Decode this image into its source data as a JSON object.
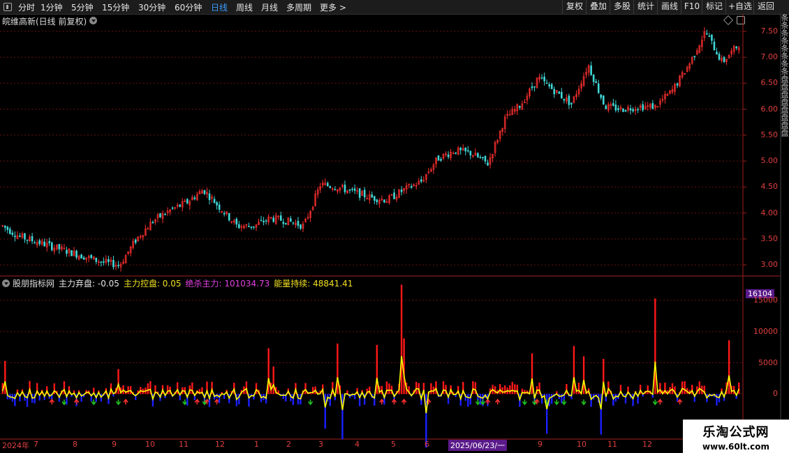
{
  "toolbar": {
    "periods": [
      "分时",
      "1分钟",
      "5分钟",
      "15分钟",
      "30分钟",
      "60分钟",
      "日线",
      "周线",
      "月线",
      "多周期",
      "更多 >"
    ],
    "active": "日线",
    "right": [
      "复权",
      "叠加",
      "多股",
      "统计",
      "画线",
      "F10",
      "标记",
      "+自选",
      "返回"
    ]
  },
  "chart_title": "皖维高新(日线 前复权)",
  "price_axis": [
    "7.50",
    "7.00",
    "6.50",
    "6.00",
    "5.50",
    "5.00",
    "4.50",
    "4.00",
    "3.50",
    "3.00"
  ],
  "indicator": {
    "name": "股朋指标网",
    "items": [
      {
        "label": "主力弃盘:",
        "value": "-0.05",
        "color": "#e6e6e6"
      },
      {
        "label": "主力控盘:",
        "value": "0.05",
        "color": "#f0e020"
      },
      {
        "label": "绝杀主力:",
        "value": "101034.73",
        "color": "#e040e0"
      },
      {
        "label": "能量持续:",
        "value": "48841.41",
        "color": "#f0e020"
      }
    ]
  },
  "ind_axis": [
    "15000",
    "10000",
    "5000",
    "0"
  ],
  "ind_current": "16104",
  "dates": [
    "2024年",
    "7",
    "8",
    "9",
    "10",
    "11",
    "12",
    "1",
    "2",
    "3",
    "4",
    "5",
    "6",
    "2025/06/23/一",
    "9",
    "10",
    "11",
    "12"
  ],
  "watermark": {
    "name": "乐淘公式网",
    "url": "www.60lt.com"
  },
  "side_strip": "条条条条条条条条盘盘盘盘盘盘盘盘",
  "chart_data": {
    "type": "candlestick",
    "price_ylim": [
      2.8,
      7.7
    ],
    "trend": [
      3.75,
      3.55,
      3.45,
      3.35,
      3.25,
      3.15,
      3.05,
      3.0,
      3.5,
      3.85,
      4.05,
      4.2,
      4.45,
      4.1,
      3.75,
      3.75,
      3.9,
      3.85,
      3.75,
      4.55,
      4.5,
      4.4,
      4.3,
      4.25,
      4.45,
      4.6,
      5.05,
      5.2,
      5.15,
      4.95,
      5.8,
      6.1,
      6.6,
      6.35,
      6.1,
      6.85,
      6.05,
      6.0,
      6.05,
      6.05,
      6.35,
      6.85,
      7.5,
      6.9,
      7.25
    ],
    "ind_ylim": [
      -7000,
      17000
    ],
    "colors": {
      "up": "#ff3030",
      "down": "#40d8d8",
      "line": "#ffff00",
      "pos": "#ff1818",
      "neg": "#1a20ff",
      "up_arrow": "#ff3030",
      "down_arrow": "#20c020"
    }
  }
}
